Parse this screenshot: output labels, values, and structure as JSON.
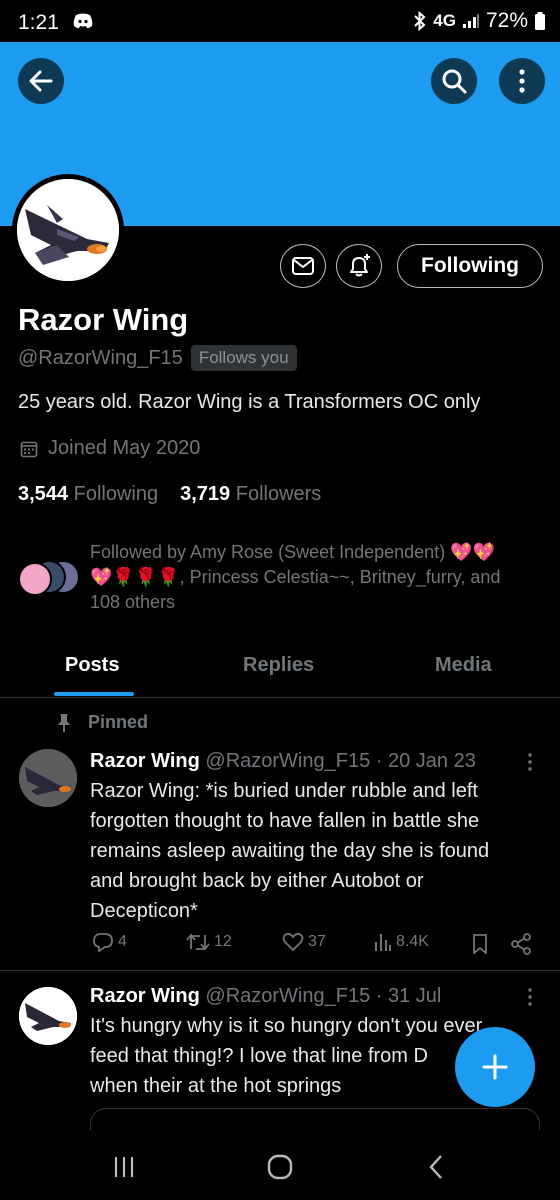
{
  "status_bar": {
    "time": "1:21",
    "network": "4G",
    "battery": "72%"
  },
  "profile": {
    "display_name": "Razor Wing",
    "handle": "@RazorWing_F15",
    "follows_you_badge": "Follows you",
    "bio": "25 years old. Razor Wing is a Transformers OC only",
    "joined": "Joined May 2020",
    "following_count": "3,544",
    "following_label": "Following",
    "followers_count": "3,719",
    "followers_label": "Followers",
    "follow_button_label": "Following",
    "followed_by_line1": "Followed by Amy Rose (Sweet Independent) 💖💖",
    "followed_by_line2": "💖🌹🌹🌹, Princess Celestia~~, Britney_furry, and",
    "followed_by_line3": "108 others"
  },
  "tabs": [
    {
      "label": "Posts",
      "active": true
    },
    {
      "label": "Replies",
      "active": false
    },
    {
      "label": "Media",
      "active": false
    }
  ],
  "pinned_label": "Pinned",
  "tweets": [
    {
      "name": "Razor Wing",
      "meta": "@RazorWing_F15 · 20 Jan 23",
      "lines": [
        "Razor Wing: *is buried under rubble and left",
        "forgotten thought to have fallen in battle she",
        "remains asleep awaiting the day she is found",
        "and brought back by either Autobot or",
        "Decepticon*"
      ],
      "replies": "4",
      "retweets": "12",
      "likes": "37",
      "views": "8.4K"
    },
    {
      "name": "Razor Wing",
      "meta": "@RazorWing_F15 · 31 Jul",
      "lines": [
        "It's hungry why is it so hungry don't you ever",
        "feed that thing!? I love that line from D",
        "when their at the hot springs"
      ]
    }
  ],
  "colors": {
    "accent": "#1d9bf0",
    "background": "#000000",
    "muted": "#71767b"
  },
  "icons": [
    "back-arrow-icon",
    "search-icon",
    "more-vertical-icon",
    "mail-icon",
    "bell-plus-icon",
    "calendar-icon",
    "pin-icon",
    "reply-icon",
    "retweet-icon",
    "like-icon",
    "views-icon",
    "bookmark-icon",
    "share-icon",
    "plus-icon"
  ]
}
